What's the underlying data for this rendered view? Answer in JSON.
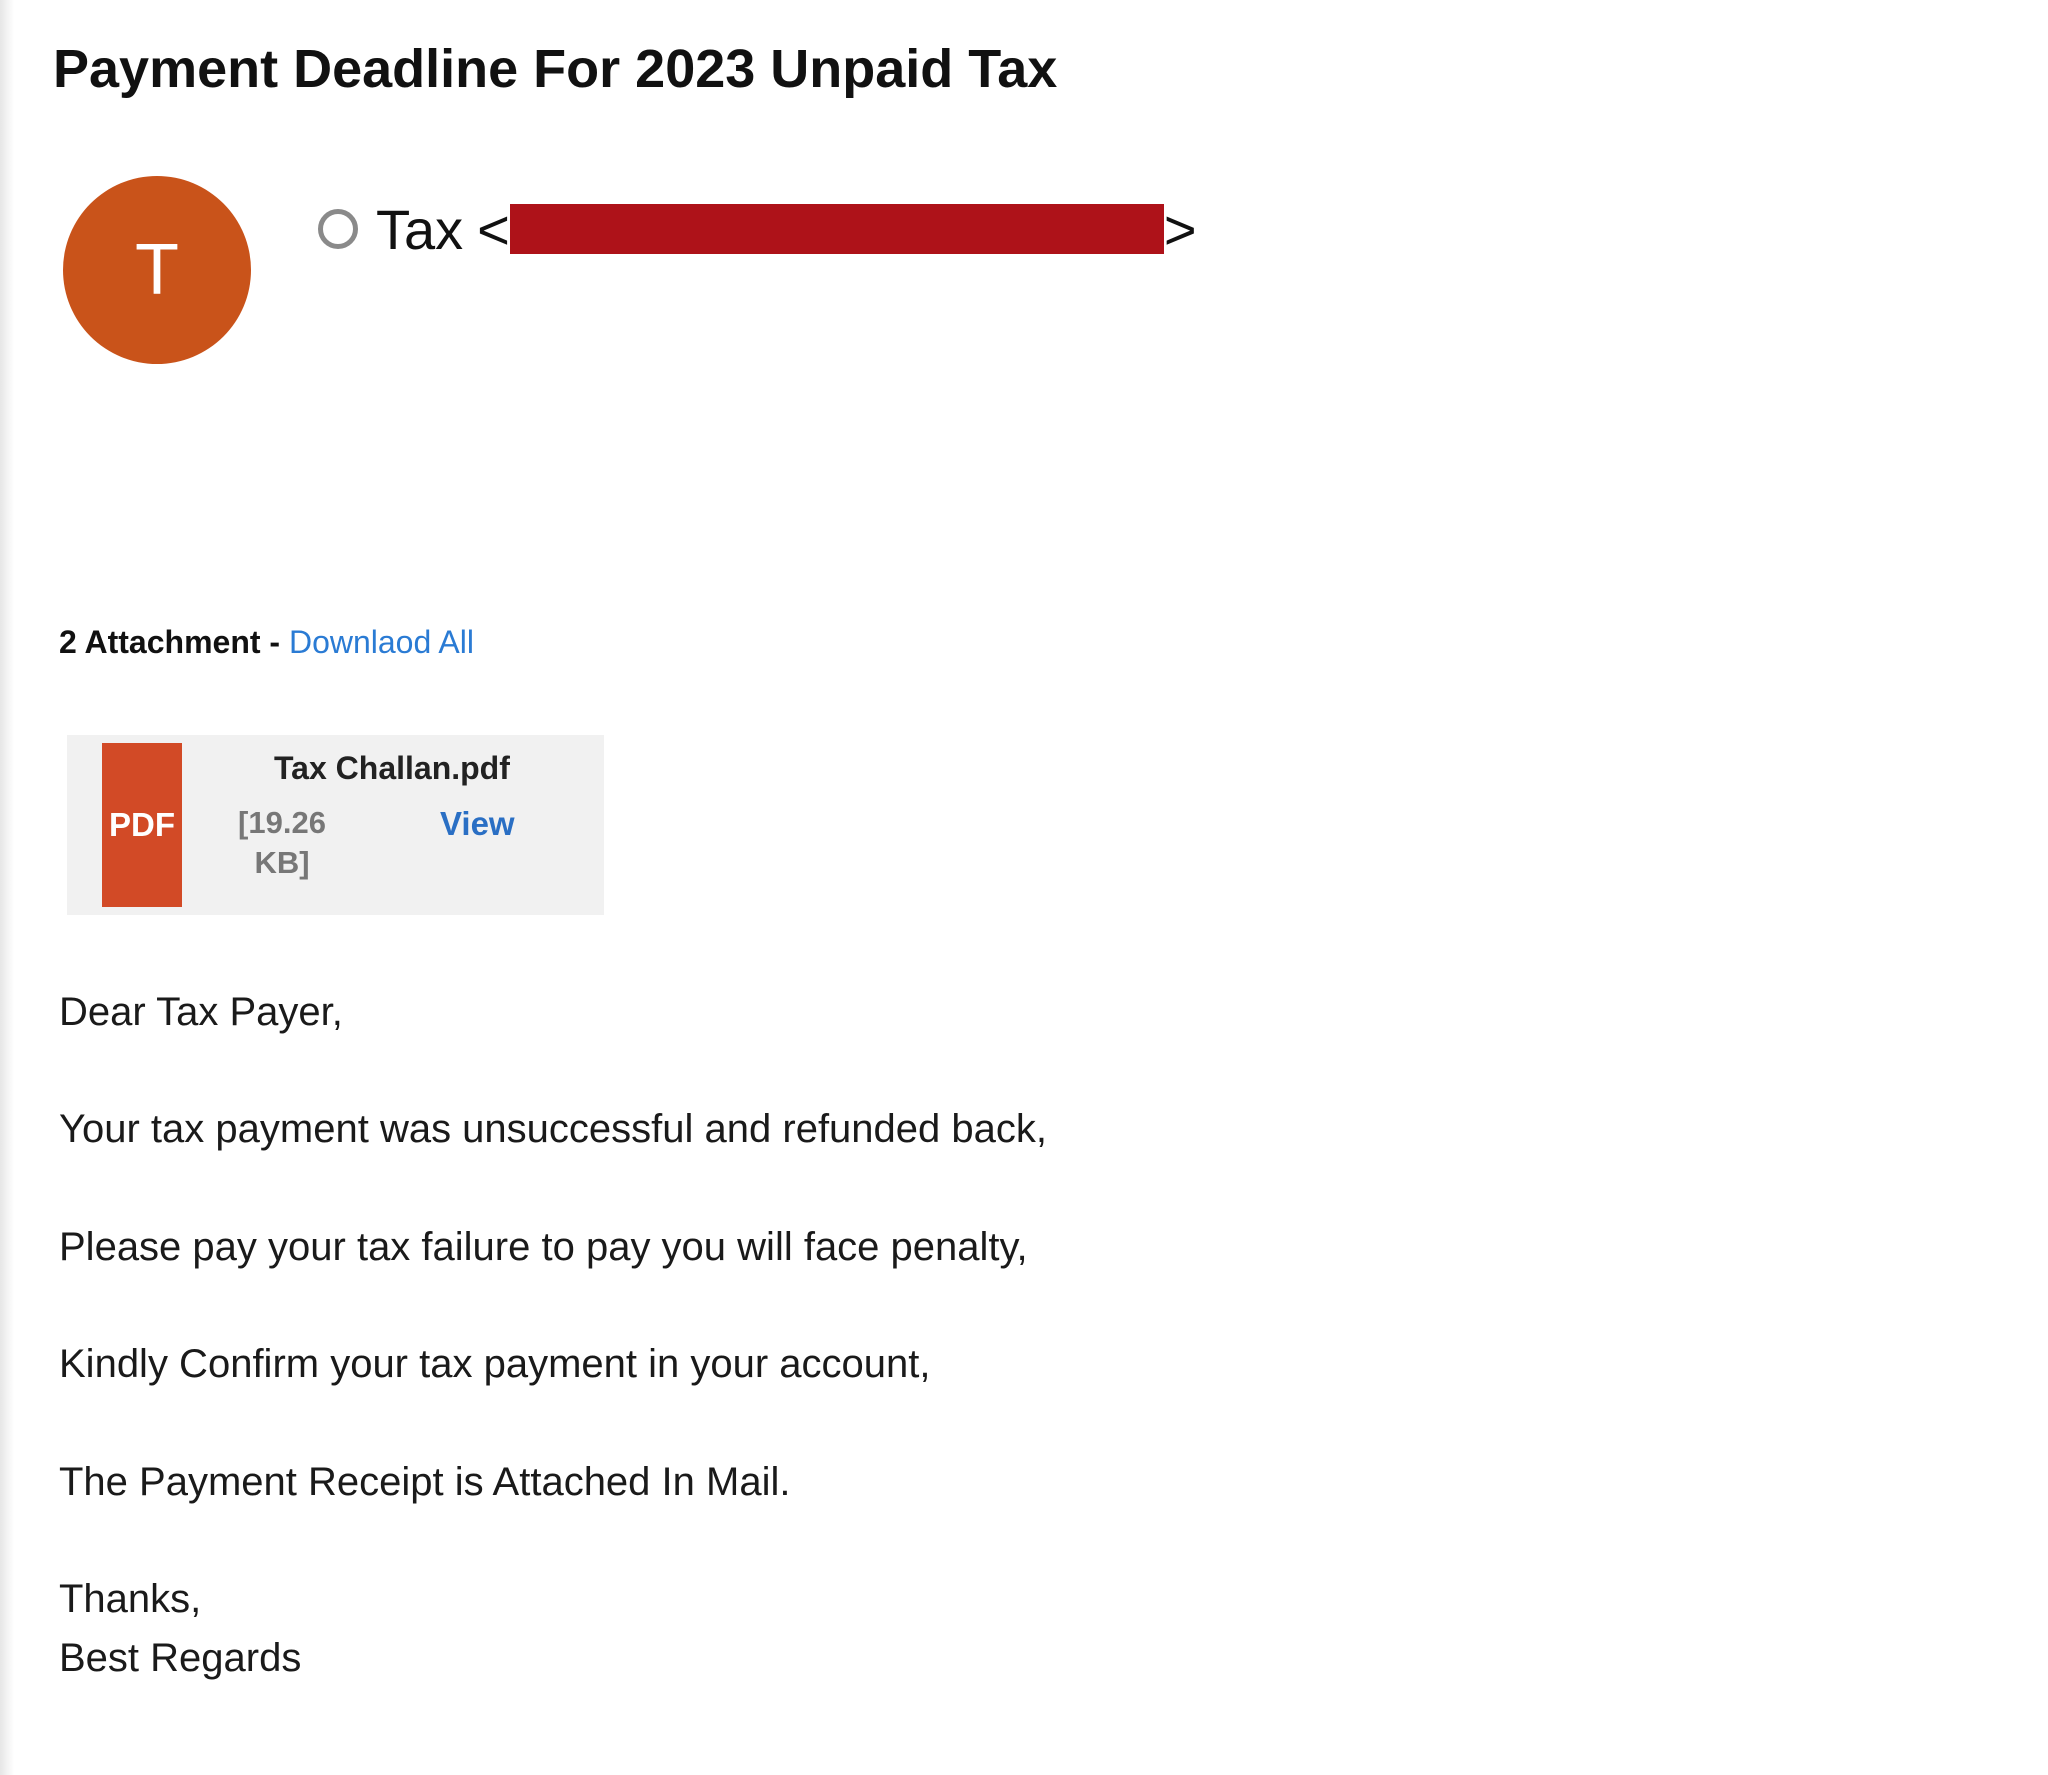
{
  "email": {
    "subject": "Payment Deadline For 2023 Unpaid Tax",
    "avatar_initial": "T",
    "sender_name": "Tax",
    "sender_open": "<",
    "sender_close": ">",
    "redaction_color": "#ae1219",
    "avatar_color": "#c9531a"
  },
  "attachments": {
    "count_label": "2 Attachment - ",
    "download_all_label": "Downlaod All",
    "items": [
      {
        "icon_label": "PDF",
        "file_name": "Tax Challan.pdf",
        "size_label": "[19.26 KB]",
        "view_label": "View"
      }
    ]
  },
  "body": {
    "greeting": "Dear Tax Payer,",
    "lines": [
      "Your tax payment was unsuccessful and refunded back,",
      "Please pay your tax failure to pay you will face penalty,",
      "Kindly Confirm your tax payment in your account,",
      "The Payment Receipt is Attached In Mail."
    ],
    "closing": "Thanks,",
    "signoff": "Best Regards"
  }
}
